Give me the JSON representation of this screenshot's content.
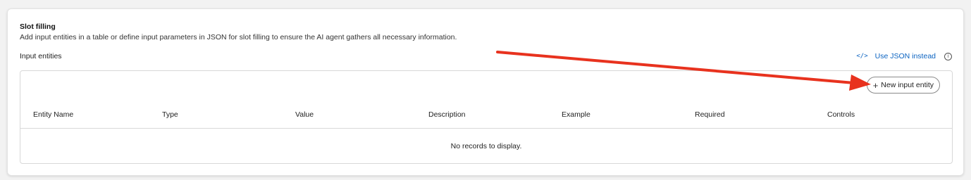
{
  "section": {
    "title": "Slot filling",
    "description": "Add input entities in a table or define input parameters in JSON for slot filling to ensure the AI agent gathers all necessary information."
  },
  "input_entities": {
    "label": "Input entities",
    "json_link_label": "Use JSON instead",
    "json_link_icon": "code-icon",
    "info_icon": "info-icon",
    "new_button_label": "New input entity",
    "new_button_icon": "plus-icon",
    "columns": [
      "Entity Name",
      "Type",
      "Value",
      "Description",
      "Example",
      "Required",
      "Controls"
    ],
    "empty_message": "No records to display."
  },
  "colors": {
    "link": "#0b63c1",
    "annotation_arrow": "#e8321e"
  }
}
